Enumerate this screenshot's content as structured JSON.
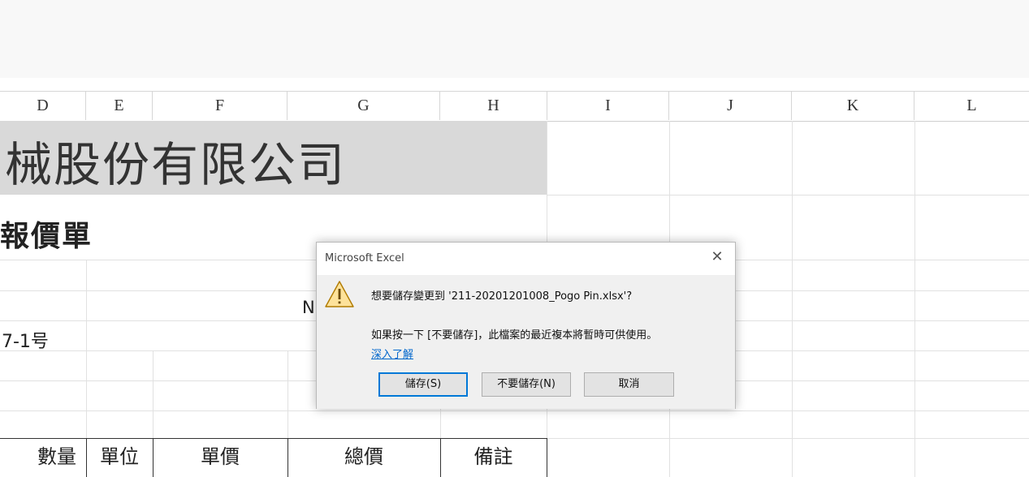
{
  "columns": [
    "D",
    "E",
    "F",
    "G",
    "H",
    "I",
    "J",
    "K",
    "L"
  ],
  "sheet": {
    "company_title": "械股份有限公司",
    "document_title": "報價單",
    "address_fragment": "7-1号",
    "partial_cell": "N",
    "table_headers": [
      "數量",
      "單位",
      "單價",
      "總價",
      "備註"
    ]
  },
  "dialog": {
    "title": "Microsoft Excel",
    "close_glyph": "✕",
    "message": "想要儲存變更到 '211-20201201008_Pogo Pin.xlsx'?",
    "detail": "如果按一下 [不要儲存]，此檔案的最近複本將暫時可供使用。",
    "learn_more": "深入了解",
    "buttons": {
      "save": "儲存(S)",
      "dont_save": "不要儲存(N)",
      "cancel": "取消"
    },
    "icon": "warning-icon",
    "accent": "#0078d7"
  }
}
